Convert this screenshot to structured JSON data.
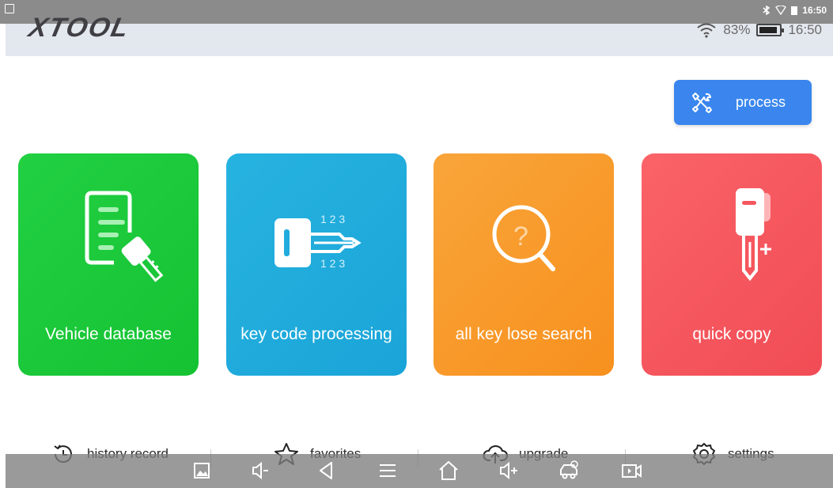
{
  "status_bar": {
    "time": "16:50",
    "icons": [
      "screenshot-icon",
      "bluetooth-icon",
      "wifi-outline-icon",
      "battery-icon"
    ]
  },
  "app_bar": {
    "logo": "XTOOL",
    "wifi_icon": "wifi-icon",
    "battery_percent": "83%",
    "time": "16:50"
  },
  "process_button": {
    "label": "process",
    "icon": "tools-icon"
  },
  "tiles": [
    {
      "label": "Vehicle database",
      "icon": "document-key-icon",
      "color": "#1ec73c"
    },
    {
      "label": "key code processing",
      "icon": "key-code-icon",
      "color": "#21acdd",
      "digits_top": "1 2 3",
      "digits_bottom": "1 2 3"
    },
    {
      "label": "all key lose search",
      "icon": "question-search-icon",
      "color": "#f89a2a"
    },
    {
      "label": "quick copy",
      "icon": "key-copy-icon",
      "color": "#f5565e"
    }
  ],
  "bottom_tabs": [
    {
      "label": "history record",
      "icon": "history-icon"
    },
    {
      "label": "favorites",
      "icon": "star-icon"
    },
    {
      "label": "upgrade",
      "icon": "cloud-upload-icon"
    },
    {
      "label": "settings",
      "icon": "gear-icon"
    }
  ],
  "nav_bar": {
    "icons": [
      "gallery-icon",
      "volume-down-icon",
      "back-icon",
      "menu-icon",
      "home-icon",
      "volume-up-icon",
      "car-diagnostic-icon",
      "video-record-icon"
    ]
  }
}
